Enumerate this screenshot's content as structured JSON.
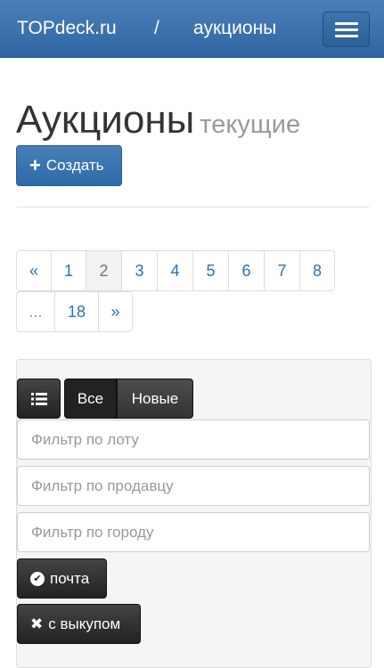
{
  "navbar": {
    "brand": "TOPdeck.ru",
    "separator": "/",
    "section": "аукционы",
    "menu_icon": "hamburger-icon"
  },
  "header": {
    "title": "Аукционы",
    "subtitle": "текущие",
    "create_label": "Создать",
    "create_icon": "plus-icon"
  },
  "pagination": {
    "prev": "«",
    "pages": [
      "1",
      "2",
      "3",
      "4",
      "5",
      "6",
      "7",
      "8"
    ],
    "active_page": "2",
    "ellipsis": "...",
    "last": "18",
    "next": "»"
  },
  "filters": {
    "list_icon": "list-icon",
    "tab_all": "Все",
    "tab_new": "Новые",
    "lot_placeholder": "Фильтр по лоту",
    "seller_placeholder": "Фильтр по продавцу",
    "city_placeholder": "Фильтр по городу",
    "mail_label": "почта",
    "mail_icon": "check-circle-icon",
    "buyout_label": "с выкупом",
    "buyout_icon": "close-icon"
  }
}
